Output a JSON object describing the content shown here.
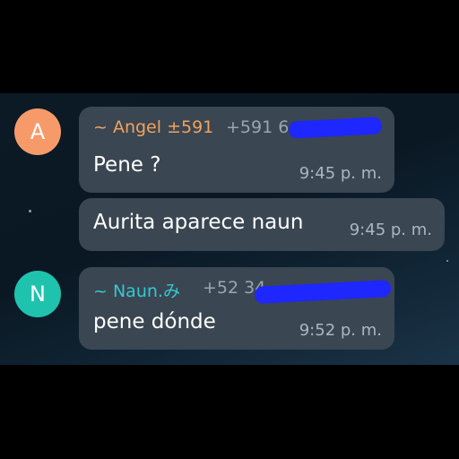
{
  "colors": {
    "avatar_a": "#f79a6a",
    "avatar_n": "#1fc3ad",
    "bubble": "#3a4651",
    "sender_angel": "#f2a25f",
    "sender_naun": "#35c7d4",
    "redaction": "#1f27ff"
  },
  "messages": [
    {
      "avatar_letter": "A",
      "sender_name": "~ Angel ±591",
      "phone": "+591 6",
      "text": "Pene ?",
      "time": "9:45 p. m."
    },
    {
      "text": "Aurita aparece naun",
      "time": "9:45 p. m."
    },
    {
      "avatar_letter": "N",
      "sender_name": "~ Naun.み",
      "phone": "+52 34",
      "text": "pene dónde",
      "time": "9:52 p. m."
    }
  ]
}
